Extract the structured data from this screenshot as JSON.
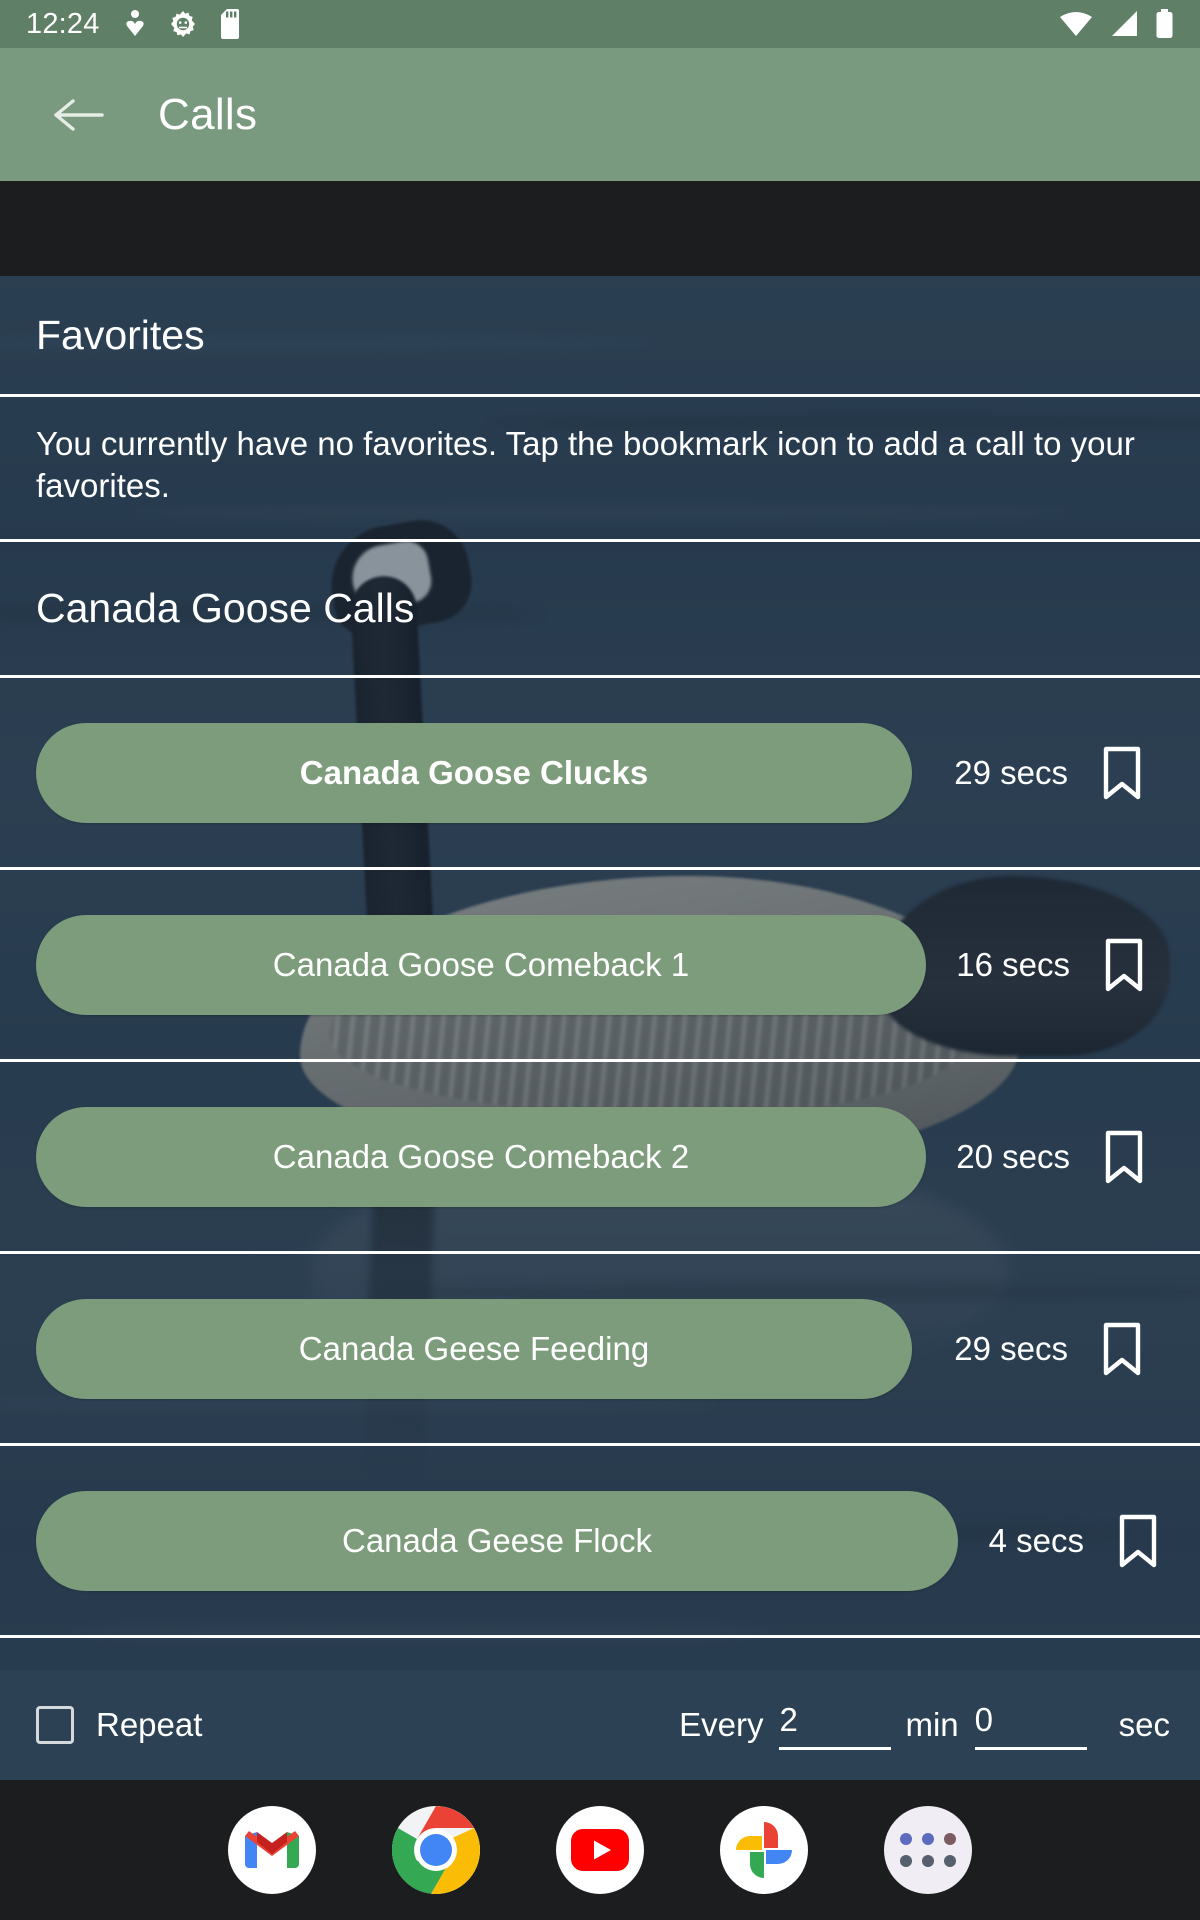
{
  "status_bar": {
    "time": "12:24",
    "left_icons": [
      "person-heart-icon",
      "gear-icon",
      "sd-card-icon"
    ],
    "right_icons": [
      "wifi-icon",
      "cell-signal-icon",
      "battery-icon"
    ],
    "background_color": "#5f7f66"
  },
  "app_bar": {
    "back_icon": "back-arrow-icon",
    "title": "Calls",
    "background_color": "#7a9a80"
  },
  "favorites": {
    "heading": "Favorites",
    "empty_message": "You currently have no favorites. Tap the bookmark icon to add a call to your favorites."
  },
  "calls_section": {
    "heading": "Canada Goose Calls",
    "bookmark_icon": "bookmark-outline-icon",
    "pill_color": "#7d9c7c",
    "items": [
      {
        "name": "Canada Goose Clucks",
        "duration": "29 secs",
        "selected": true,
        "bookmarked": false
      },
      {
        "name": "Canada Goose Comeback 1",
        "duration": "16 secs",
        "selected": false,
        "bookmarked": false
      },
      {
        "name": "Canada Goose Comeback 2",
        "duration": "20 secs",
        "selected": false,
        "bookmarked": false
      },
      {
        "name": "Canada Geese Feeding",
        "duration": "29 secs",
        "selected": false,
        "bookmarked": false
      },
      {
        "name": "Canada Geese Flock",
        "duration": "4 secs",
        "selected": false,
        "bookmarked": false
      }
    ]
  },
  "repeat_bar": {
    "checkbox_icon": "checkbox-unchecked-icon",
    "checked": false,
    "repeat_label": "Repeat",
    "every_label": "Every",
    "minutes_value": "2",
    "minutes_unit": "min",
    "seconds_value": "0",
    "seconds_unit": "sec"
  },
  "dock": {
    "background_color": "#1b1d1f",
    "apps": [
      {
        "name": "gmail-app-icon",
        "label": "Gmail"
      },
      {
        "name": "chrome-app-icon",
        "label": "Chrome"
      },
      {
        "name": "youtube-app-icon",
        "label": "YouTube"
      },
      {
        "name": "google-photos-app-icon",
        "label": "Photos"
      },
      {
        "name": "app-drawer-icon",
        "label": "All apps"
      }
    ]
  }
}
